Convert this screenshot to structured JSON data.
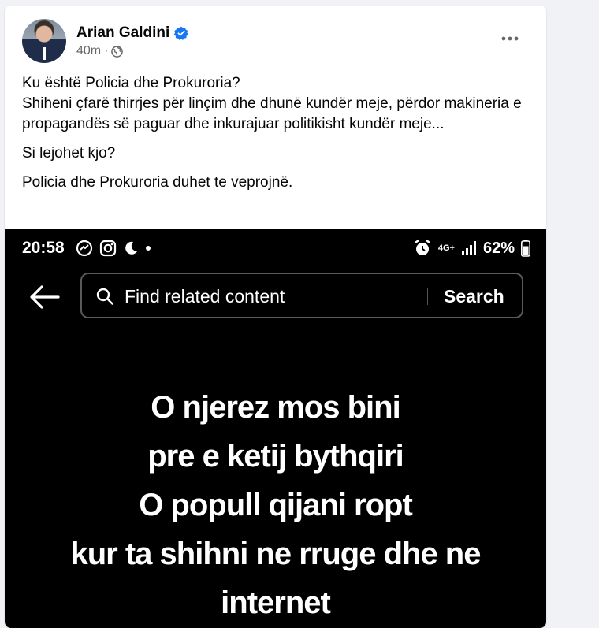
{
  "post": {
    "author": "Arian Galdini",
    "verified": true,
    "timestamp": "40m",
    "privacy_separator": "·",
    "privacy_icon": "globe-icon",
    "more_icon": "more-options-icon",
    "text_paragraphs": [
      "Ku është Policia dhe Prokuroria?\nShiheni çfarë thirrjes për linçim dhe dhunë kundër meje, përdor makineria e propagandës së paguar dhe inkurajuar politikisht kundër meje...",
      "Si lejohet kjo?",
      "Policia dhe Prokuroria duhet te veprojnë."
    ]
  },
  "screenshot": {
    "status": {
      "time": "20:58",
      "network": "4G+",
      "battery": "62%"
    },
    "search": {
      "placeholder": "Find related content",
      "button": "Search"
    },
    "overlay_lines": [
      "O njerez mos bini",
      "pre e ketij bythqiri",
      "O popull qijani ropt",
      "kur ta shihni ne rruge dhe ne",
      "internet"
    ]
  },
  "colors": {
    "verified_badge": "#1877f2",
    "meta_text": "#65676b",
    "page_background": "#f0f2f5"
  }
}
